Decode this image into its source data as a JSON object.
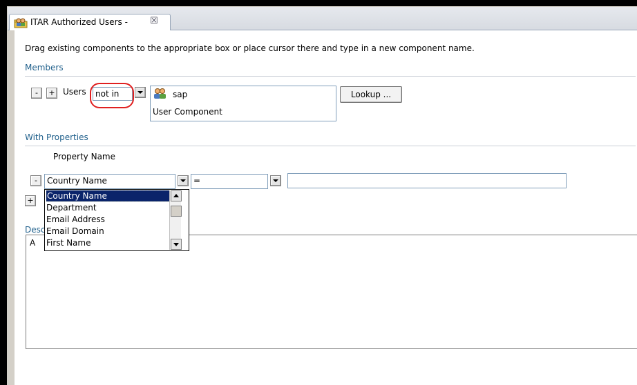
{
  "tab": {
    "title": "ITAR Authorized Users -",
    "close_glyph": "☒"
  },
  "instructions": "Drag existing components to the appropriate box or place cursor there and type in a new component name.",
  "members": {
    "heading": "Members",
    "minus": "-",
    "plus": "+",
    "users_label": "Users",
    "operator": "not in",
    "components": [
      {
        "name": "sap",
        "icon": "user-group-icon"
      },
      {
        "name": "User Component"
      }
    ],
    "lookup_label": "Lookup ..."
  },
  "properties": {
    "heading": "With Properties",
    "column_header": "Property Name",
    "minus": "-",
    "plus": "+",
    "property_value": "Country Name",
    "operator_value": "=",
    "value_text": "",
    "dropdown_options": [
      "Country Name",
      "Department",
      "Email Address",
      "Email Domain",
      "First Name"
    ],
    "selected_option": "Country Name"
  },
  "description": {
    "heading_partial": "Desc",
    "text": "A"
  },
  "colors": {
    "accent": "#1f5f8b",
    "selection": "#0a246a",
    "highlight_circle": "#e02020"
  }
}
